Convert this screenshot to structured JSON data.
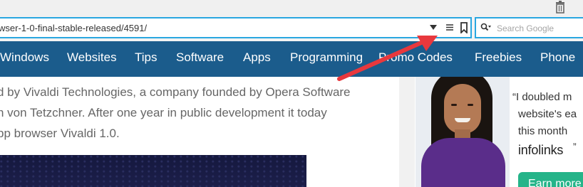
{
  "browser": {
    "url": "wser-1-0-final-stable-released/4591/",
    "search_placeholder": "Search Google",
    "icons": {
      "trash": "trash-icon",
      "dropdown": "dropdown-arrow-icon",
      "reader": "reader-view-icon",
      "bookmark": "bookmark-icon",
      "search": "search-icon"
    }
  },
  "nav": {
    "items": [
      "Windows",
      "Websites",
      "Tips",
      "Software",
      "Apps",
      "Programming",
      "Promo Codes",
      "Freebies",
      "Phone"
    ],
    "background": "#1b5c8c"
  },
  "article": {
    "lines": [
      "d by Vivaldi Technologies, a company founded by Opera Software",
      "n von Tetzchner. After one year in public development it today",
      "pp browser Vivaldi 1.0."
    ]
  },
  "ad": {
    "quote_lines": [
      "“I doubled m",
      "website's ea",
      "this month"
    ],
    "brand": "infolinks",
    "quote_close": "”",
    "button_label": "Earn more",
    "button_color": "#25b489"
  },
  "annotation": {
    "color": "#e8383d"
  },
  "colors": {
    "accent": "#2aa7e0",
    "text": "#666666"
  }
}
